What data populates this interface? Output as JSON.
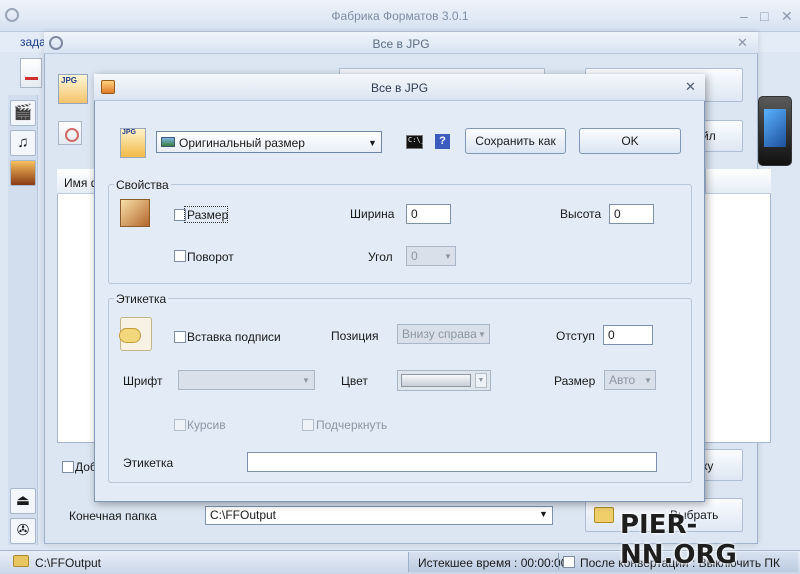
{
  "main_window": {
    "title": "Фабрика Форматов 3.0.1",
    "menu_task": "зада",
    "controls": {
      "minimize": "–",
      "maximize": "□",
      "close": "✕"
    }
  },
  "converter_window": {
    "title": "Все в JPG",
    "jpg_badge": "JPG",
    "file_button_partial": "йл",
    "list_name_column_partial": "Имя ф",
    "add_checkbox_partial": "Доб",
    "bottom_button_partial": "ку",
    "destination_label": "Конечная папка",
    "destination_value": "C:\\FFOutput",
    "choose_button_label": "Выбрать"
  },
  "dialog": {
    "title": "Все в JPG",
    "jpg_badge": "JPG",
    "size_preset": "Оригинальный размер",
    "cmd_icon_text": "C:\\_",
    "help_icon_text": "?",
    "save_as_label": "Сохранить как",
    "ok_label": "OK",
    "properties": {
      "title": "Свойства",
      "resize_label": "Размер",
      "width_label": "Ширина",
      "width_value": "0",
      "height_label": "Высота",
      "height_value": "0",
      "rotate_label": "Поворот",
      "angle_label": "Угол",
      "angle_value": "0"
    },
    "label_group": {
      "title": "Этикетка",
      "insert_caption_label": "Вставка подписи",
      "position_label": "Позиция",
      "position_value": "Внизу справа",
      "indent_label": "Отступ",
      "indent_value": "0",
      "font_label": "Шрифт",
      "font_value": "",
      "color_label": "Цвет",
      "size_label": "Размер",
      "size_value": "Авто",
      "italic_label": "Курсив",
      "underline_label": "Подчеркнуть",
      "label_text_label": "Этикетка",
      "label_text_value": ""
    }
  },
  "statusbar": {
    "path": "C:\\FFOutput",
    "elapsed": "Истекшее время : 00:00:00",
    "after_conversion": "После конвертации : Выключить ПК"
  },
  "watermark": "PIER-NN.ORG"
}
